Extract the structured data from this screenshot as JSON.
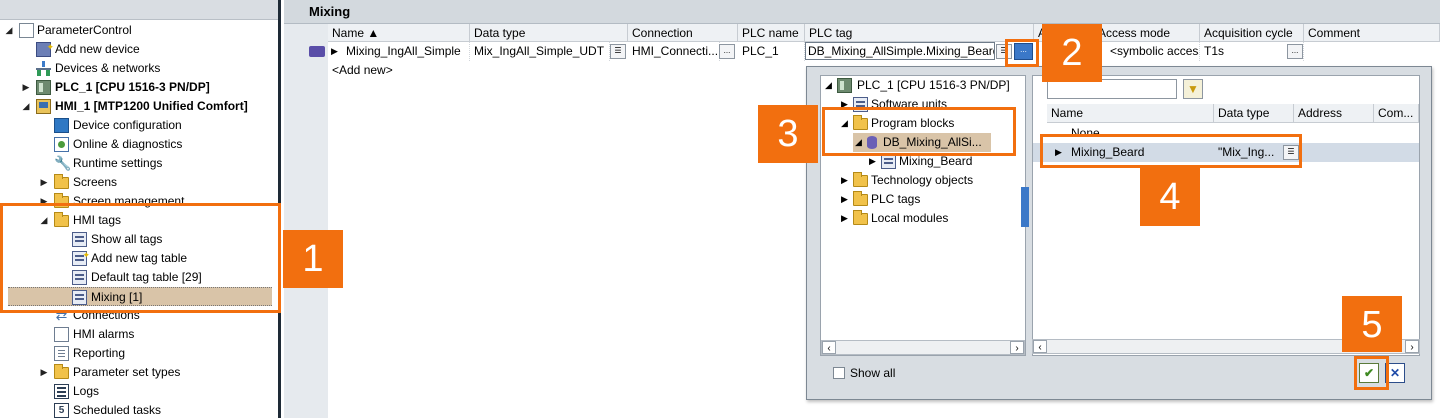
{
  "tree": {
    "items": [
      {
        "label": "ParameterControl",
        "icon": "project-icon"
      },
      {
        "label": "Add new device",
        "icon": "add-device-icon"
      },
      {
        "label": "Devices & networks",
        "icon": "network-icon"
      },
      {
        "label": "PLC_1 [CPU 1516-3 PN/DP]",
        "icon": "plc-icon"
      },
      {
        "label": "HMI_1 [MTP1200 Unified Comfort]",
        "icon": "hmi-icon"
      },
      {
        "label": "Device configuration",
        "icon": "device-config-icon"
      },
      {
        "label": "Online & diagnostics",
        "icon": "diagnostics-icon"
      },
      {
        "label": "Runtime settings",
        "icon": "wrench-icon"
      },
      {
        "label": "Screens",
        "icon": "folder-icon"
      },
      {
        "label": "Screen management",
        "icon": "folder-icon"
      },
      {
        "label": "HMI tags",
        "icon": "folder-icon"
      },
      {
        "label": "Show all tags",
        "icon": "tag-table-icon"
      },
      {
        "label": "Add new tag table",
        "icon": "add-tag-table-icon"
      },
      {
        "label": "Default tag table [29]",
        "icon": "tag-table-icon"
      },
      {
        "label": "Mixing [1]",
        "icon": "tag-table-icon"
      },
      {
        "label": "Connections",
        "icon": "connections-icon"
      },
      {
        "label": "HMI alarms",
        "icon": "alarms-icon"
      },
      {
        "label": "Reporting",
        "icon": "report-icon"
      },
      {
        "label": "Parameter set types",
        "icon": "folder-icon"
      },
      {
        "label": "Logs",
        "icon": "logs-icon"
      },
      {
        "label": "Scheduled tasks",
        "icon": "scheduled-tasks-icon"
      }
    ]
  },
  "editor": {
    "title": "Mixing",
    "columns": [
      "Name ▲",
      "Data type",
      "Connection",
      "PLC name",
      "PLC tag",
      "A",
      "Access mode",
      "Acquisition cycle",
      "Comment"
    ],
    "row": {
      "name": "Mixing_IngAll_Simple",
      "data_type": "Mix_IngAll_Simple_UDT",
      "connection": "HMI_Connecti...",
      "plc_name": "PLC_1",
      "plc_tag": "DB_Mixing_AllSimple.Mixing_Beard",
      "access_mode": "<symbolic access>",
      "acquisition_cycle": "T1s"
    },
    "add_new": "<Add new>",
    "ellipsis": "..."
  },
  "popup": {
    "tree": [
      {
        "label": "PLC_1 [CPU 1516-3 PN/DP]"
      },
      {
        "label": "Software units"
      },
      {
        "label": "Program blocks"
      },
      {
        "label": "DB_Mixing_AllSi..."
      },
      {
        "label": "Mixing_Beard"
      },
      {
        "label": "Technology objects"
      },
      {
        "label": "PLC tags"
      },
      {
        "label": "Local modules"
      }
    ],
    "list_columns": [
      "Name",
      "Data type",
      "Address",
      "Com..."
    ],
    "list_rows": [
      {
        "name": "None",
        "type": ""
      },
      {
        "name": "Mixing_Beard",
        "type": "\"Mix_Ing..."
      }
    ],
    "show_all": "Show all",
    "ok": "✔",
    "cancel": "✕"
  },
  "callouts": [
    "1",
    "2",
    "3",
    "4",
    "5"
  ],
  "colors": {
    "accent": "#f26f0f",
    "selection": "#d9c4a8"
  }
}
